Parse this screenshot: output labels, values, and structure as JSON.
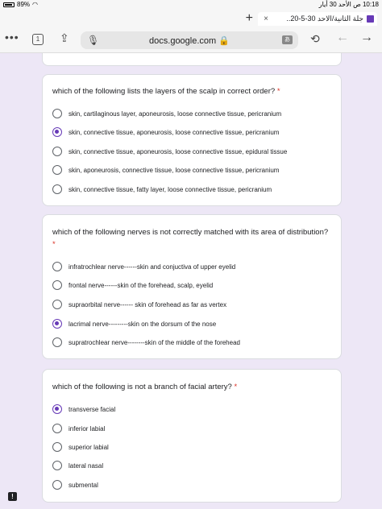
{
  "status": {
    "battery": "89%",
    "time": "10:18 ص  الأحد 30 أيار"
  },
  "browser": {
    "tab_title": "جلة الثانية/الاحد 30-5-20..",
    "new_tab": "+",
    "close": "×",
    "tab_count": "1",
    "url": "docs.google.com 🔒"
  },
  "questions": [
    {
      "title": "which of the following lists the layers of the scalp in correct order?",
      "required": "*",
      "options": [
        {
          "label": "skin, cartilaginous layer, aponeurosis, loose connective tissue, pericranium",
          "selected": false
        },
        {
          "label": "skin, connective tissue, aponeurosis, loose connective tissue, pericranium",
          "selected": true
        },
        {
          "label": "skin, connective tissue, aponeurosis, loose connective tissue, epidural tissue",
          "selected": false
        },
        {
          "label": "skin, aponeurosis, connective tissue, loose connective tissue, pericranium",
          "selected": false
        },
        {
          "label": "skin, connective tissue, fatty layer, loose connective tissue, pericranium",
          "selected": false
        }
      ]
    },
    {
      "title": "which of the following nerves is not correctly matched with its area of distribution?",
      "required": "*",
      "options": [
        {
          "label": "infratrochlear nerve------skin and conjuctiva of upper eyelid",
          "selected": false
        },
        {
          "label": "frontal nerve------skin of the forehead, scalp, eyelid",
          "selected": false
        },
        {
          "label": "supraorbital nerve------ skin of forehead as far as vertex",
          "selected": false
        },
        {
          "label": "lacrimal nerve---------skin on the dorsum of the nose",
          "selected": true
        },
        {
          "label": "supratrochlear nerve--------skin of the middle of the forehead",
          "selected": false
        }
      ]
    },
    {
      "title": "which of the following is not a branch of facial artery?",
      "required": "*",
      "options": [
        {
          "label": "transverse facial",
          "selected": true
        },
        {
          "label": "inferior labial",
          "selected": false
        },
        {
          "label": "superior labial",
          "selected": false
        },
        {
          "label": "lateral nasal",
          "selected": false
        },
        {
          "label": "submental",
          "selected": false
        }
      ]
    }
  ],
  "report_label": "!"
}
